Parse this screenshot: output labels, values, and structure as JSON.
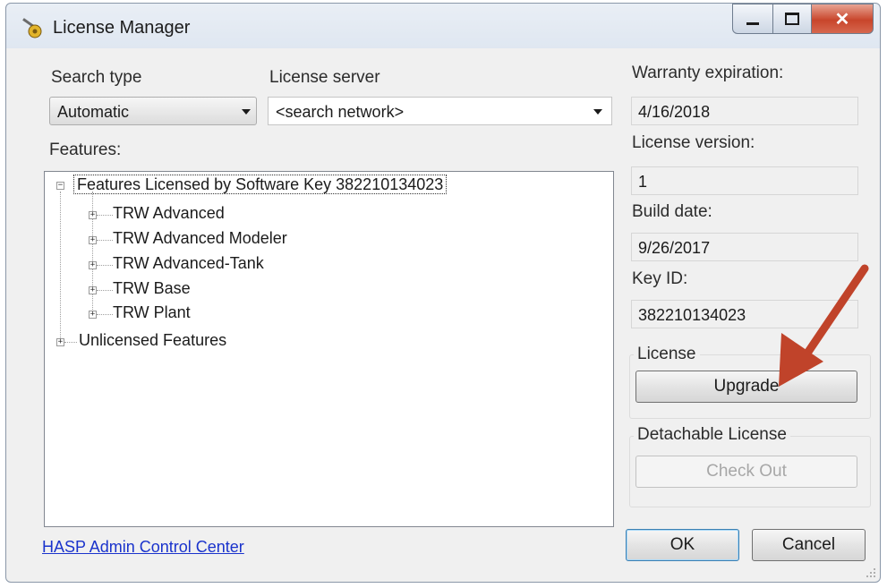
{
  "window": {
    "title": "License Manager",
    "close_glyph": "✕"
  },
  "search": {
    "type_label": "Search type",
    "type_value": "Automatic",
    "server_label": "License server",
    "server_value": "<search network>"
  },
  "features": {
    "label": "Features:",
    "root": "Features Licensed by Software Key 382210134023",
    "children": [
      "TRW Advanced",
      "TRW Advanced Modeler",
      "TRW Advanced-Tank",
      "TRW Base",
      "TRW Plant"
    ],
    "unlicensed": "Unlicensed Features"
  },
  "info": {
    "warranty_label": "Warranty expiration:",
    "warranty_value": "4/16/2018",
    "version_label": "License version:",
    "version_value": "1",
    "build_label": "Build date:",
    "build_value": "9/26/2017",
    "key_label": "Key ID:",
    "key_value": "382210134023"
  },
  "license_group": {
    "title": "License",
    "upgrade": "Upgrade"
  },
  "detach_group": {
    "title": "Detachable License",
    "checkout": "Check Out"
  },
  "footer": {
    "link": "HASP Admin Control Center",
    "ok": "OK",
    "cancel": "Cancel"
  },
  "annotation": {
    "arrow_color": "#c0432a"
  }
}
